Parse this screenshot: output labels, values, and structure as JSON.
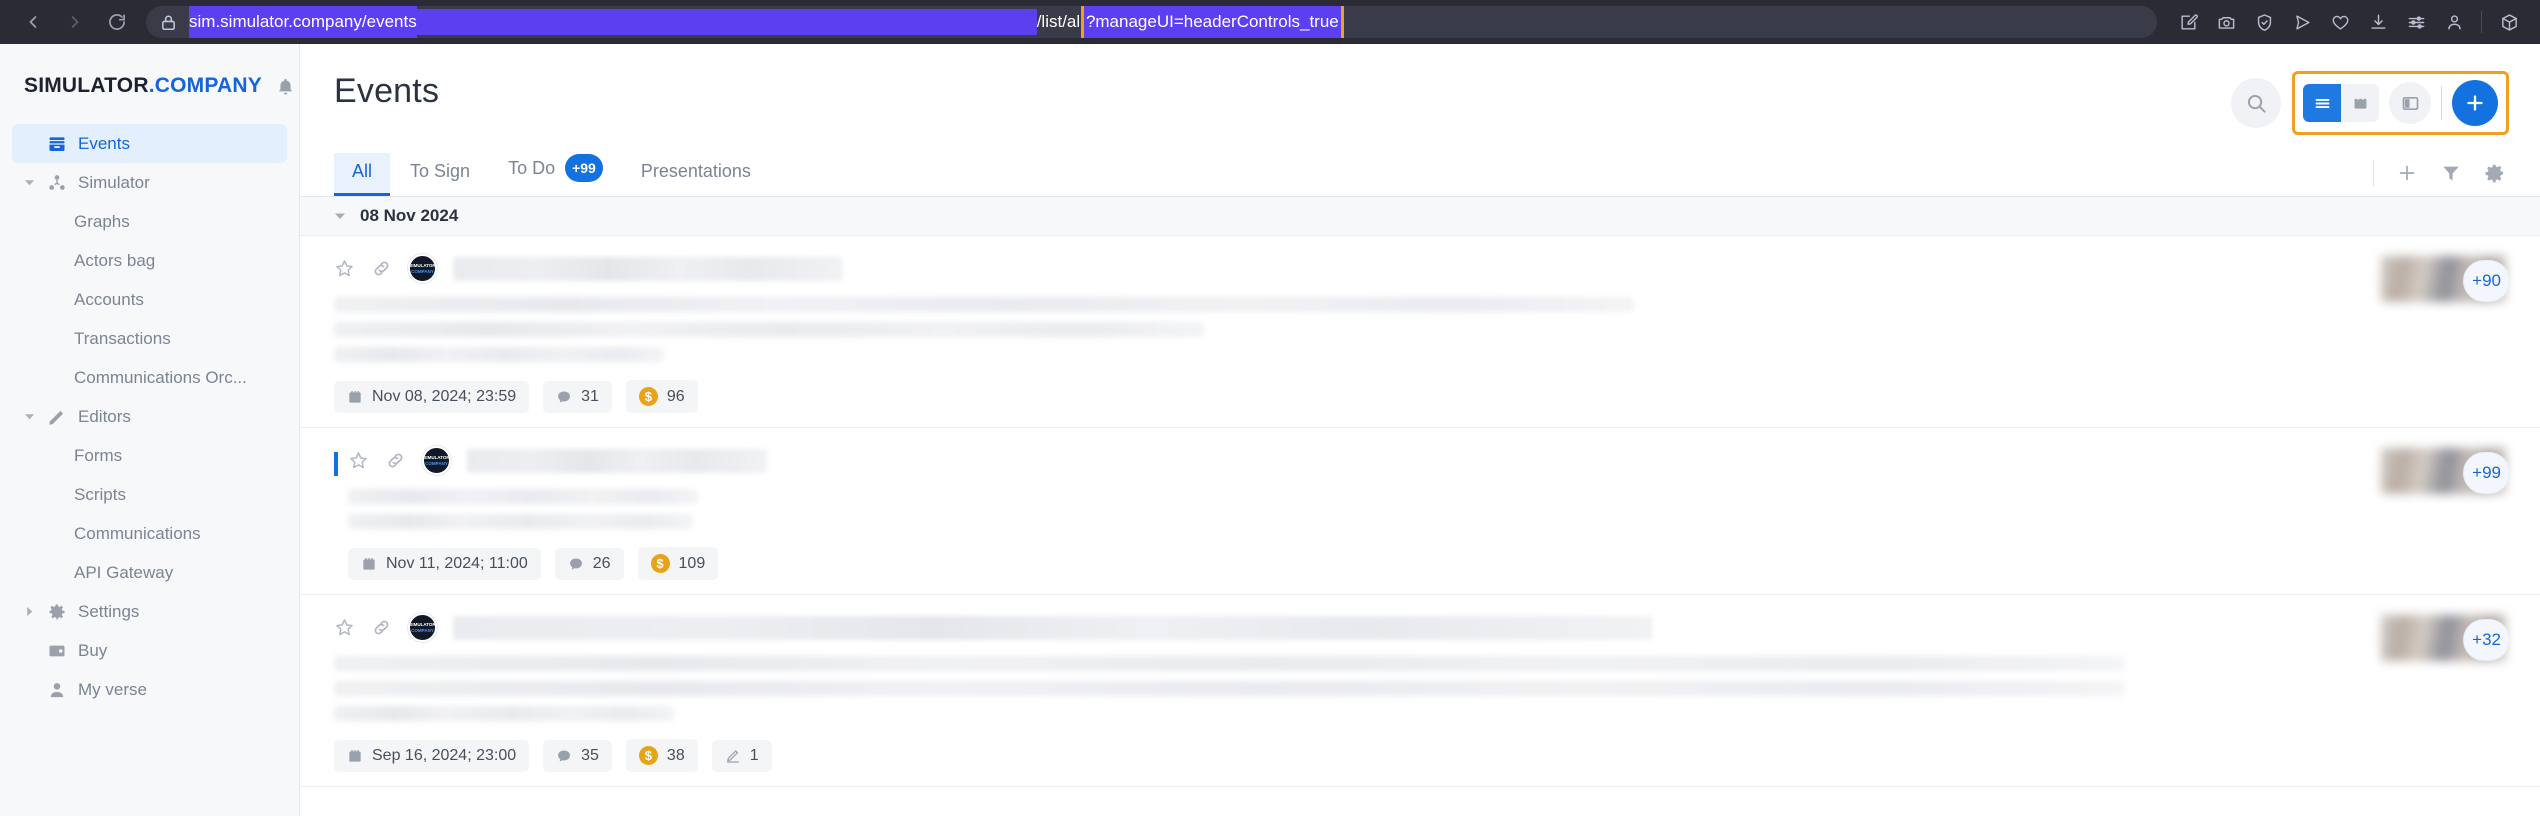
{
  "browser": {
    "nav": {
      "back": "back-arrow",
      "forward": "forward-arrow",
      "reload": "reload"
    },
    "url": {
      "lock": "lock-icon",
      "prefix": "sim.simulator.company/events",
      "path": "/list/all",
      "query": "?manageUI=headerControls_true"
    },
    "toolbar_icons": [
      "edit-note-icon",
      "camera-icon",
      "shield-check-icon",
      "send-icon",
      "heart-icon",
      "download-icon",
      "sliders-icon",
      "profile-icon",
      "cube-icon"
    ]
  },
  "sidebar": {
    "brand": {
      "name": "SIMULATOR",
      "suffix": ".COMPANY",
      "bell": "bell-icon"
    },
    "items": [
      {
        "label": "Events",
        "icon": "inbox-icon",
        "active": true,
        "level": 0,
        "caret": ""
      },
      {
        "label": "Simulator",
        "icon": "network-icon",
        "active": false,
        "level": 0,
        "caret": "down"
      },
      {
        "label": "Graphs",
        "icon": "",
        "active": false,
        "level": 1,
        "caret": ""
      },
      {
        "label": "Actors bag",
        "icon": "",
        "active": false,
        "level": 1,
        "caret": ""
      },
      {
        "label": "Accounts",
        "icon": "",
        "active": false,
        "level": 1,
        "caret": ""
      },
      {
        "label": "Transactions",
        "icon": "",
        "active": false,
        "level": 1,
        "caret": ""
      },
      {
        "label": "Communications Orc...",
        "icon": "",
        "active": false,
        "level": 1,
        "caret": ""
      },
      {
        "label": "Editors",
        "icon": "pencil-icon",
        "active": false,
        "level": 0,
        "caret": "down"
      },
      {
        "label": "Forms",
        "icon": "",
        "active": false,
        "level": 1,
        "caret": ""
      },
      {
        "label": "Scripts",
        "icon": "",
        "active": false,
        "level": 1,
        "caret": ""
      },
      {
        "label": "Communications",
        "icon": "",
        "active": false,
        "level": 1,
        "caret": ""
      },
      {
        "label": "API Gateway",
        "icon": "",
        "active": false,
        "level": 1,
        "caret": ""
      },
      {
        "label": "Settings",
        "icon": "gear-icon",
        "active": false,
        "level": 0,
        "caret": "right"
      },
      {
        "label": "Buy",
        "icon": "wallet-icon",
        "active": false,
        "level": 0,
        "caret": ""
      },
      {
        "label": "My verse",
        "icon": "user-icon",
        "active": false,
        "level": 0,
        "caret": ""
      }
    ]
  },
  "header": {
    "title": "Events",
    "search_icon": "search-icon",
    "view_list_icon": "list-view-icon",
    "view_card_icon": "card-view-icon",
    "view_split_icon": "split-view-icon",
    "add_icon": "plus-icon",
    "highlighted_group": "header-controls"
  },
  "tabs": {
    "items": [
      {
        "label": "All",
        "badge": "",
        "active": true
      },
      {
        "label": "To Sign",
        "badge": "",
        "active": false
      },
      {
        "label": "To Do",
        "badge": "+99",
        "active": false
      },
      {
        "label": "Presentations",
        "badge": "",
        "active": false
      }
    ],
    "actions": [
      "plus-icon",
      "filter-icon",
      "gear-icon"
    ]
  },
  "list": {
    "date_group": "08 Nov 2024",
    "events": [
      {
        "unread": false,
        "star_icon": "star-icon",
        "link_icon": "link-icon",
        "avatar": {
          "line1": "SIMULATOR",
          "line2": "COMPANY"
        },
        "badges": [
          {
            "icon": "calendar-icon",
            "value": "Nov 08, 2024; 23:59"
          },
          {
            "icon": "comment-icon",
            "value": "31"
          },
          {
            "icon": "coin-icon",
            "value": "96"
          }
        ],
        "participants_more": "+90"
      },
      {
        "unread": true,
        "star_icon": "star-icon",
        "link_icon": "link-icon",
        "avatar": {
          "line1": "SIMULATOR",
          "line2": "COMPANY"
        },
        "badges": [
          {
            "icon": "calendar-icon",
            "value": "Nov 11, 2024; 11:00"
          },
          {
            "icon": "comment-icon",
            "value": "26"
          },
          {
            "icon": "coin-icon",
            "value": "109"
          }
        ],
        "participants_more": "+99"
      },
      {
        "unread": false,
        "star_icon": "star-icon",
        "link_icon": "link-icon",
        "avatar": {
          "line1": "SIMULATOR",
          "line2": "COMPANY"
        },
        "badges": [
          {
            "icon": "calendar-icon",
            "value": "Sep 16, 2024; 23:00"
          },
          {
            "icon": "comment-icon",
            "value": "35"
          },
          {
            "icon": "coin-icon",
            "value": "38"
          },
          {
            "icon": "signature-icon",
            "value": "1"
          }
        ],
        "participants_more": "+32"
      }
    ]
  },
  "colors": {
    "accent": "#1565d8",
    "fab": "#1472e0",
    "highlight_outline": "#f0a020",
    "coin": "#e8a317",
    "url_selection": "#5b3ff0"
  }
}
